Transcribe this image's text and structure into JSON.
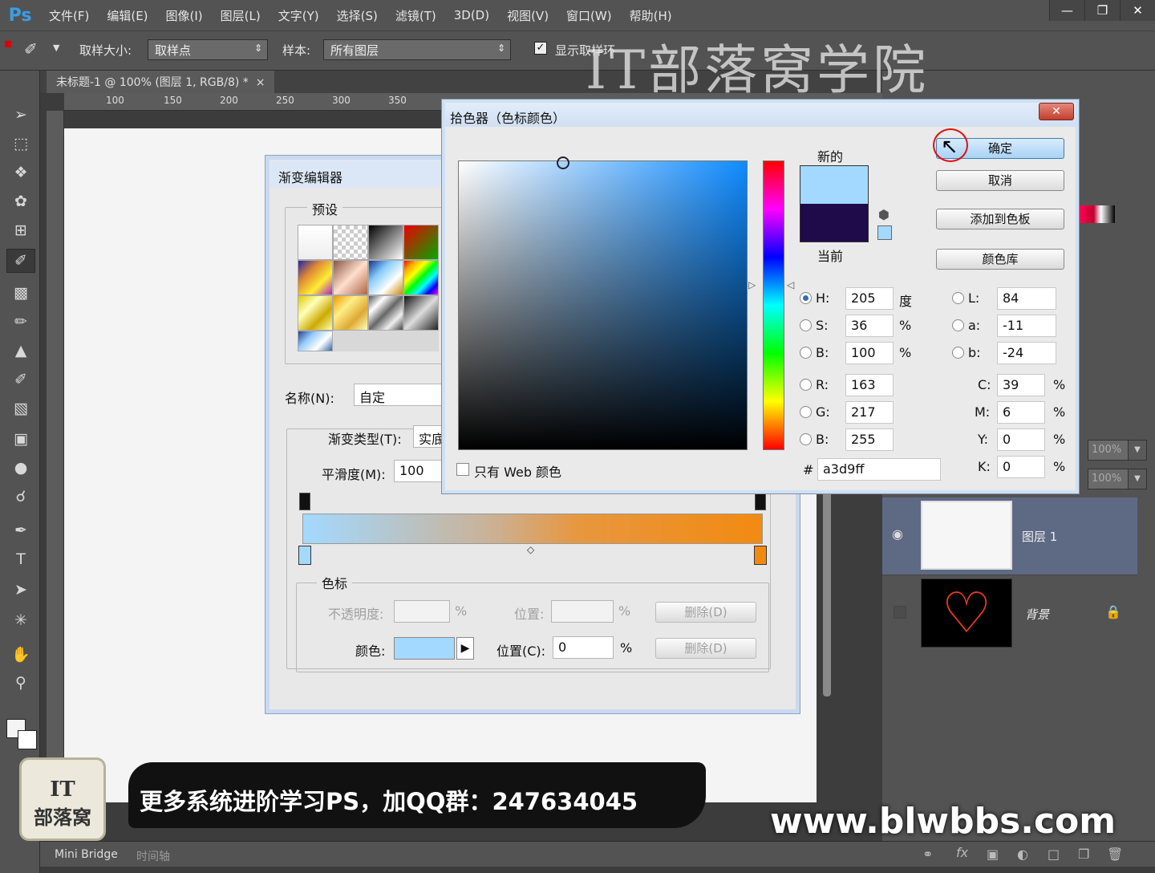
{
  "app": {
    "logo": "Ps"
  },
  "menu": [
    "文件(F)",
    "编辑(E)",
    "图像(I)",
    "图层(L)",
    "文字(Y)",
    "选择(S)",
    "滤镜(T)",
    "3D(D)",
    "视图(V)",
    "窗口(W)",
    "帮助(H)"
  ],
  "window_controls": [
    "minimize-icon",
    "restore-icon",
    "close-icon"
  ],
  "options": {
    "sample_size_label": "取样大小:",
    "sample_size_value": "取样点",
    "sample_label": "样本:",
    "sample_value": "所有图层",
    "show_ring_label": "显示取样环"
  },
  "doc_tab": {
    "title": "未标题-1 @ 100% (图层 1, RGB/8) *",
    "close": "×"
  },
  "ruler": {
    "top": [
      "100",
      "150",
      "200",
      "250",
      "300",
      "350"
    ]
  },
  "gradient_editor": {
    "title": "渐变编辑器",
    "presets_label": "预设",
    "name_label": "名称(N):",
    "name_value": "自定",
    "type_label": "渐变类型(T):",
    "type_value": "实底",
    "smooth_label": "平滑度(M):",
    "smooth_value": "100",
    "stops_label": "色标",
    "opacity_label": "不透明度:",
    "pct": "%",
    "location_label": "位置:",
    "delete_label": "删除(D)",
    "color_label": "颜色:",
    "location_c_label": "位置(C):",
    "location_c_value": "0",
    "stop_color": "#a3d9ff",
    "end_color": "#f28a12"
  },
  "color_picker": {
    "title": "拾色器（色标颜色）",
    "new_label": "新的",
    "current_label": "当前",
    "new_color": "#a3d9ff",
    "current_color": "#1f0a4a",
    "ok": "确定",
    "cancel": "取消",
    "add_swatch": "添加到色板",
    "libraries": "颜色库",
    "web_only": "只有 Web 颜色",
    "hex_label": "#",
    "hex": "a3d9ff",
    "hsb": [
      {
        "k": "H:",
        "v": "205",
        "u": "度"
      },
      {
        "k": "S:",
        "v": "36",
        "u": "%"
      },
      {
        "k": "B:",
        "v": "100",
        "u": "%"
      }
    ],
    "rgb": [
      {
        "k": "R:",
        "v": "163"
      },
      {
        "k": "G:",
        "v": "217"
      },
      {
        "k": "B:",
        "v": "255"
      }
    ],
    "lab": [
      {
        "k": "L:",
        "v": "84"
      },
      {
        "k": "a:",
        "v": "-11"
      },
      {
        "k": "b:",
        "v": "-24"
      }
    ],
    "cmyk": [
      {
        "k": "C:",
        "v": "39",
        "u": "%"
      },
      {
        "k": "M:",
        "v": "6",
        "u": "%"
      },
      {
        "k": "Y:",
        "v": "0",
        "u": "%"
      },
      {
        "k": "K:",
        "v": "0",
        "u": "%"
      }
    ]
  },
  "layers": {
    "opacity": "100%",
    "fill": "100%",
    "items": [
      {
        "name": "图层 1"
      },
      {
        "name": "背景"
      }
    ]
  },
  "status": {
    "mini_bridge": "Mini Bridge",
    "timeline": "时间轴"
  },
  "overlay": {
    "watermark": "IT部落窝学院",
    "banner": "更多系统进阶学习PS，加QQ群：247634045",
    "site": "www.blwbbs.com",
    "badge_line1": "IT",
    "badge_line2": "部落窝"
  }
}
